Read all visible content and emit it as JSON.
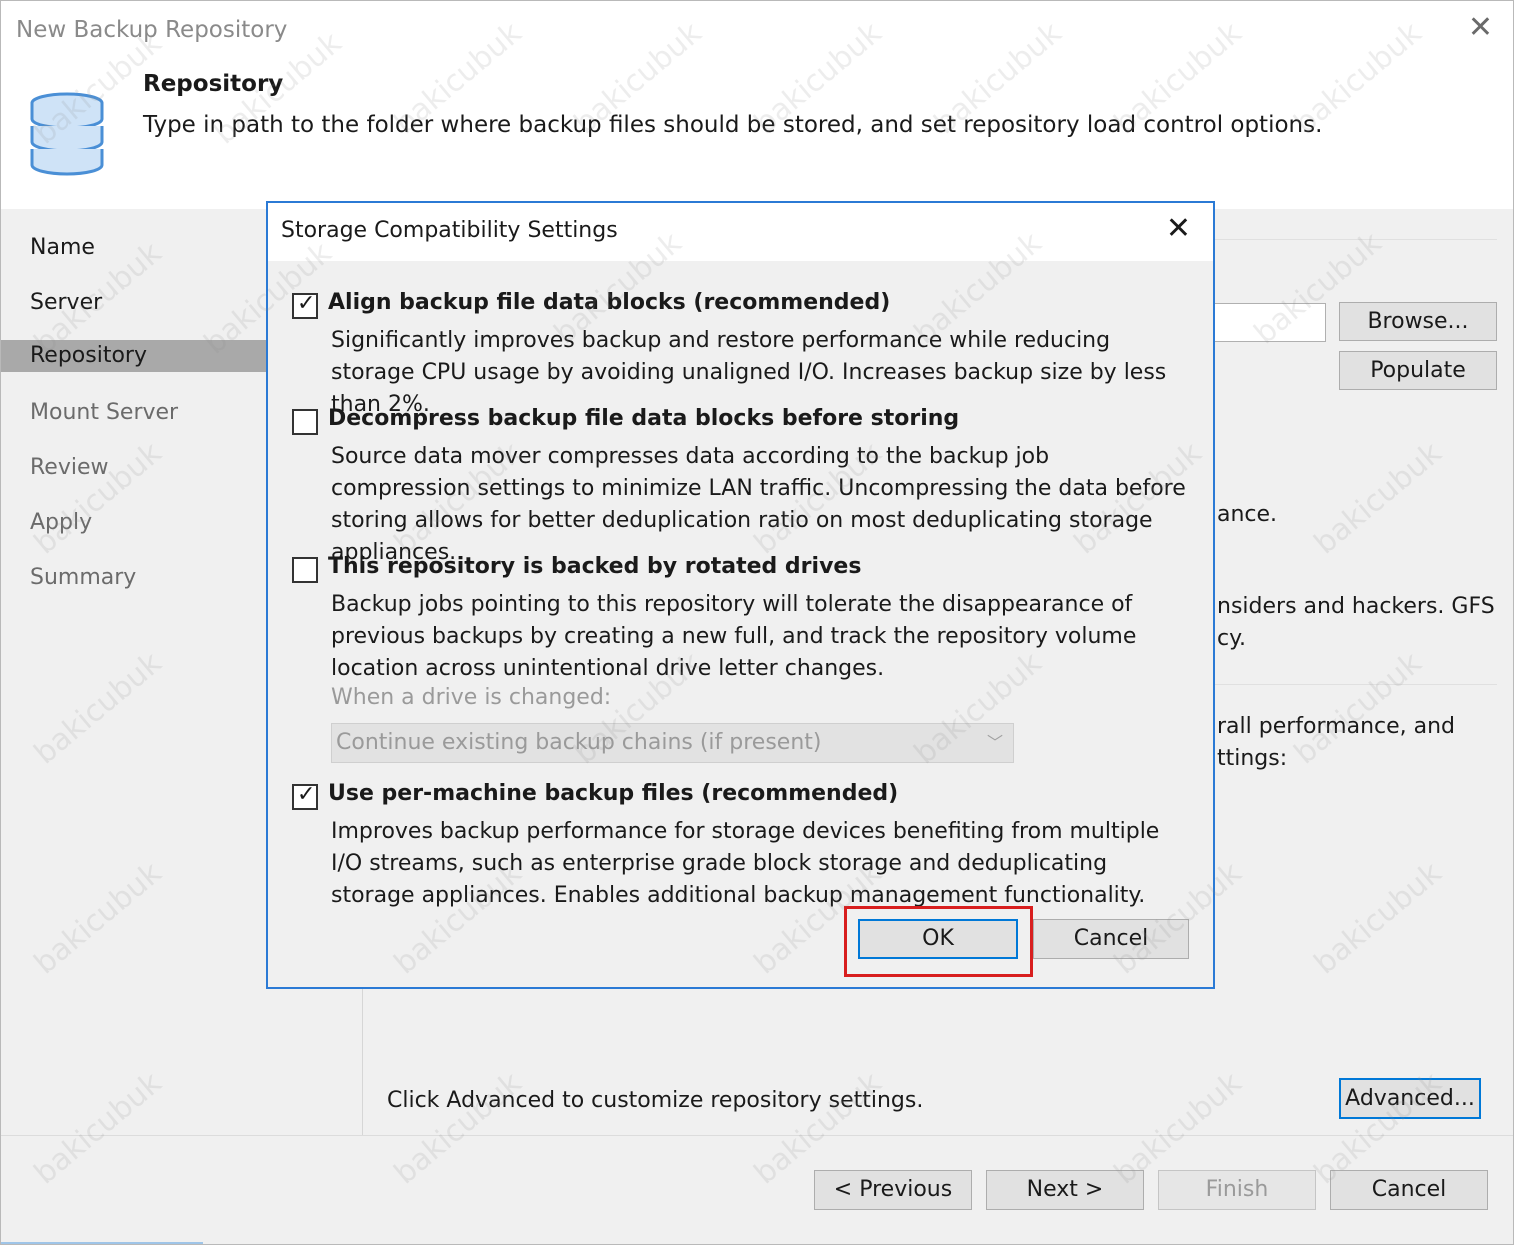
{
  "window": {
    "title": "New Backup Repository",
    "close_glyph": "✕"
  },
  "header": {
    "title": "Repository",
    "description": "Type in path to the folder where backup files should be stored, and set repository load control options.",
    "icon": "database-icon"
  },
  "sidebar": {
    "items": [
      {
        "label": "Name",
        "state": "done"
      },
      {
        "label": "Server",
        "state": "done"
      },
      {
        "label": "Repository",
        "state": "active"
      },
      {
        "label": "Mount Server",
        "state": "future"
      },
      {
        "label": "Review",
        "state": "future"
      },
      {
        "label": "Apply",
        "state": "future"
      },
      {
        "label": "Summary",
        "state": "future"
      }
    ]
  },
  "content": {
    "browse_label": "Browse...",
    "populate_label": "Populate",
    "fragment_1": "ance.",
    "fragment_2": "nsiders and hackers. GFS",
    "fragment_3": "cy.",
    "fragment_4": "rall performance, and",
    "fragment_5": "ttings:",
    "advanced_hint": "Click Advanced to customize repository settings.",
    "advanced_label": "Advanced..."
  },
  "footer": {
    "previous_label": "< Previous",
    "next_label": "Next >",
    "finish_label": "Finish",
    "cancel_label": "Cancel"
  },
  "dialog": {
    "title": "Storage Compatibility Settings",
    "close_glyph": "✕",
    "options": [
      {
        "label": "Align backup file data blocks (recommended)",
        "checked": true,
        "description": "Significantly improves backup and restore performance while reducing storage CPU usage by avoiding unaligned I/O. Increases backup size by less than 2%."
      },
      {
        "label": "Decompress backup file data blocks before storing",
        "checked": false,
        "description": "Source data mover compresses data according to the backup job compression settings to minimize LAN traffic. Uncompressing the data before storing allows for better deduplication ratio on most deduplicating storage appliances."
      },
      {
        "label": "This repository is backed by rotated drives",
        "checked": false,
        "description": "Backup jobs pointing to this repository will tolerate the disappearance of previous backups by creating a new full, and track the repository volume location across unintentional drive letter changes."
      },
      {
        "label": "Use per-machine backup files (recommended)",
        "checked": true,
        "description": "Improves backup performance for storage devices benefiting from multiple I/O streams, such as enterprise grade block storage and deduplicating storage appliances. Enables additional backup management functionality."
      }
    ],
    "drive_change_label": "When a drive is changed:",
    "drive_change_value": "Continue existing backup chains (if present)",
    "ok_label": "OK",
    "cancel_label": "Cancel"
  },
  "watermark": "bakicubuk",
  "colors": {
    "accent": "#2b7ad5",
    "highlight": "#d81e1e",
    "sidebar_active": "#a9a9a9"
  }
}
